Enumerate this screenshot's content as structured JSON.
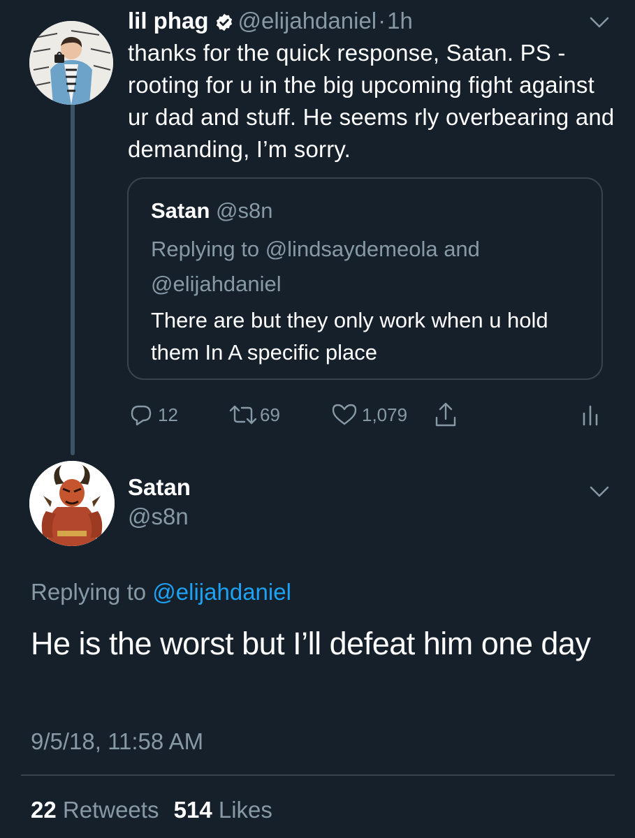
{
  "colors": {
    "background": "#15202b",
    "text_primary": "#ffffff",
    "text_secondary": "#8899a6",
    "link": "#1da1f2",
    "border": "#38444d",
    "thread_line": "#3d5466"
  },
  "tweet1": {
    "author_name": "lil phag",
    "verified_icon": "verified-badge-icon",
    "handle": "@elijahdaniel",
    "separator": "·",
    "time": "1h",
    "text": "thanks for the quick response, Satan. PS - rooting for u in the big upcoming fight against ur dad and stuff. He seems rly overbearing and demanding, I’m sorry.",
    "quoted": {
      "author_name": "Satan",
      "handle": "@s8n",
      "replying_to": "Replying to @lindsaydemeola and @elijahdaniel",
      "text": "There are but they only work when u hold them In A specific place"
    },
    "actions": {
      "replies": "12",
      "retweets": "69",
      "likes": "1,079"
    }
  },
  "tweet2": {
    "author_name": "Satan",
    "handle": "@s8n",
    "replying_prefix": "Replying to",
    "replying_handle": "@elijahdaniel",
    "text": "He is the worst but I’ll defeat him one day",
    "timestamp": "9/5/18, 11:58 AM",
    "retweets_count": "22",
    "retweets_label": "Retweets",
    "likes_count": "514",
    "likes_label": "Likes"
  }
}
